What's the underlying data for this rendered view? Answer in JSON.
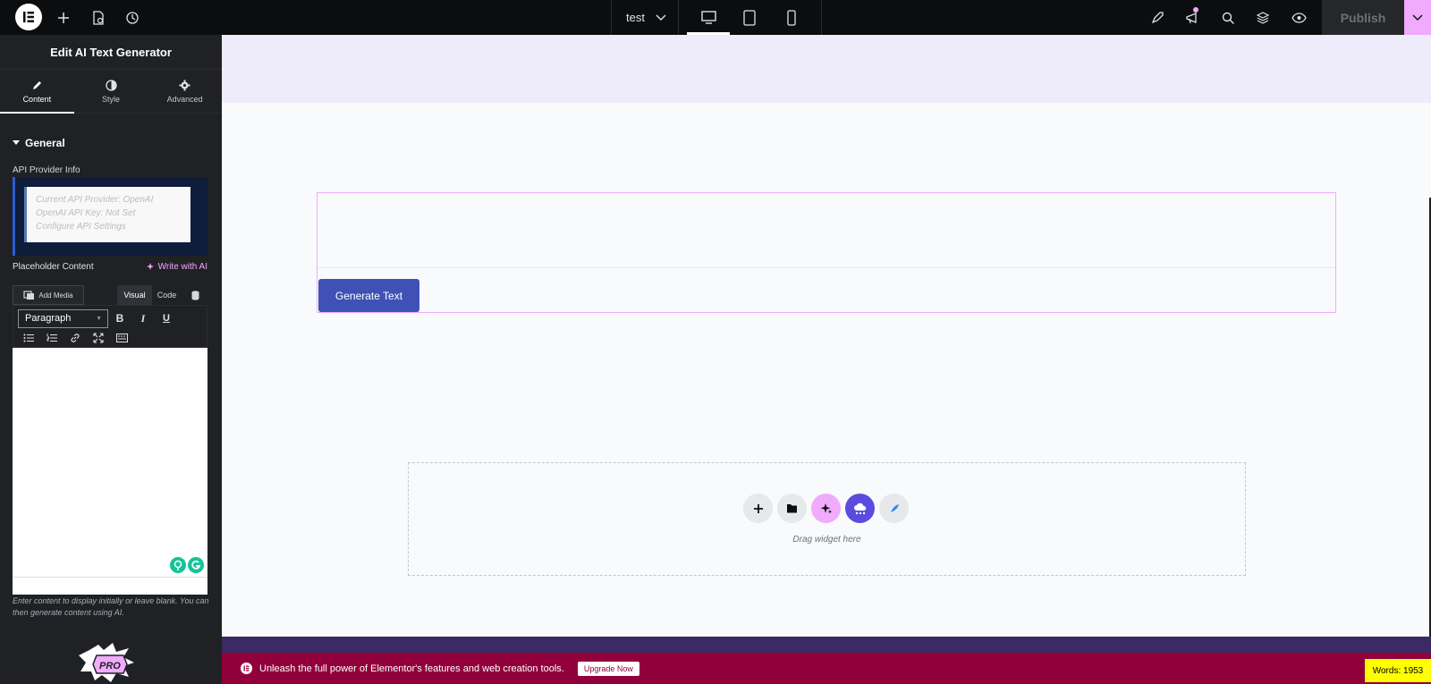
{
  "topbar": {
    "doc_title": "test",
    "publish_label": "Publish"
  },
  "panel": {
    "title": "Edit AI Text Generator",
    "tabs": [
      {
        "label": "Content"
      },
      {
        "label": "Style"
      },
      {
        "label": "Advanced"
      }
    ],
    "section_title": "General",
    "api_info_label": "API Provider Info",
    "api_info": {
      "line1": "Current API Provider: OpenAI",
      "line2": "OpenAI API Key: Not Set",
      "line3": "Configure API Settings"
    },
    "placeholder_label": "Placeholder Content",
    "write_ai_label": "Write with AI",
    "add_media_label": "Add Media",
    "visual_label": "Visual",
    "code_label": "Code",
    "format_value": "Paragraph",
    "help_text": "Enter content to display initially or leave blank. You can then generate content using AI.",
    "pro_label": "PRO"
  },
  "canvas": {
    "generate_button": "Generate Text",
    "drag_text": "Drag widget here"
  },
  "promo": {
    "text": "Unleash the full power of Elementor's features and web creation tools.",
    "button": "Upgrade Now"
  },
  "words_count": "Words: 1953",
  "colors": {
    "accent_pink": "#f0abfc",
    "button_blue": "#3f51b5",
    "promo_bg": "#92003b",
    "panel_bg": "#1f2124"
  }
}
